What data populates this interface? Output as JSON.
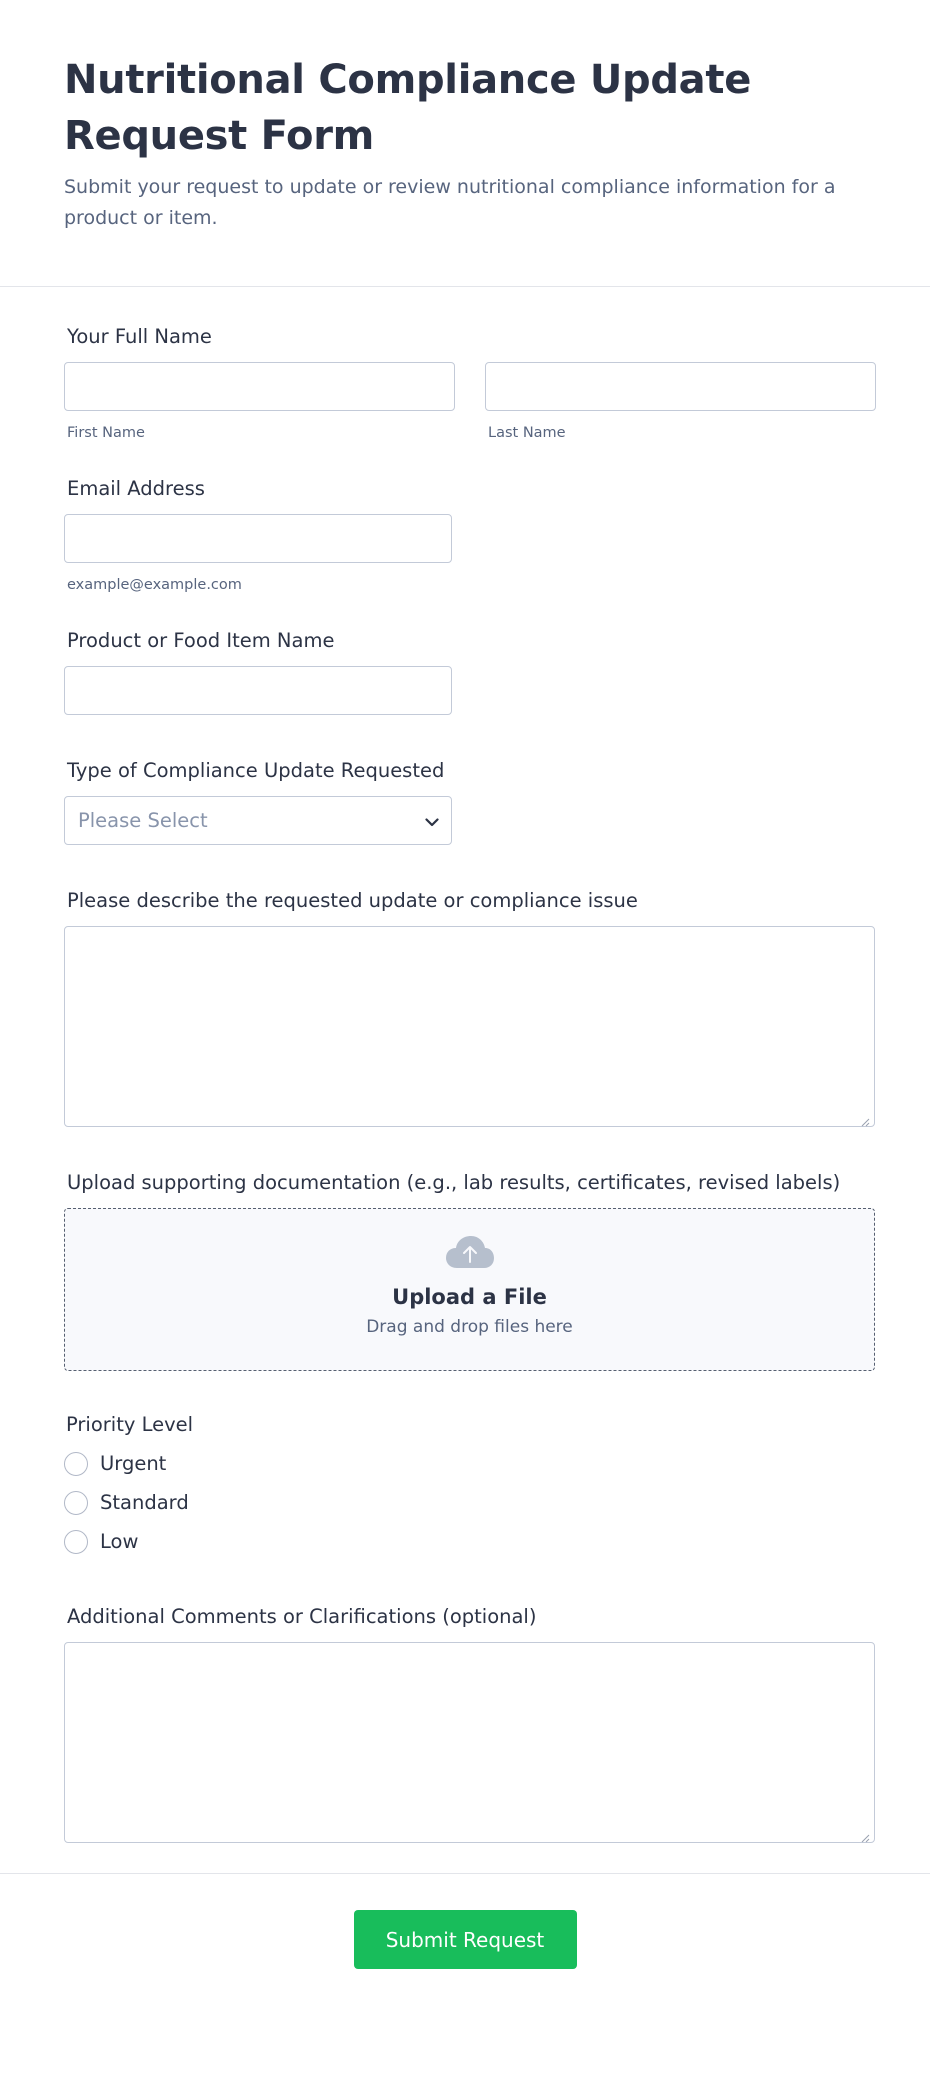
{
  "header": {
    "title": "Nutritional Compliance Update Request Form",
    "subtitle": "Submit your request to update or review nutritional compliance information for a product or item."
  },
  "fields": {
    "full_name": {
      "label": "Your Full Name",
      "first_sublabel": "First Name",
      "last_sublabel": "Last Name",
      "first_value": "",
      "last_value": ""
    },
    "email": {
      "label": "Email Address",
      "sublabel": "example@example.com",
      "value": ""
    },
    "product": {
      "label": "Product or Food Item Name",
      "value": ""
    },
    "compliance_type": {
      "label": "Type of Compliance Update Requested",
      "selected": "Please Select"
    },
    "description": {
      "label": "Please describe the requested update or compliance issue",
      "value": ""
    },
    "upload": {
      "label": "Upload supporting documentation (e.g., lab results, certificates, revised labels)",
      "title": "Upload a File",
      "hint": "Drag and drop files here"
    },
    "priority": {
      "label": "Priority Level",
      "options": [
        "Urgent",
        "Standard",
        "Low"
      ]
    },
    "comments": {
      "label": "Additional Comments or Clarifications (optional)",
      "value": ""
    }
  },
  "submit_label": "Submit Request",
  "colors": {
    "accent": "#18bd5b",
    "text": "#2c3345",
    "muted": "#57647e",
    "border": "#c3cad8"
  },
  "icons": {
    "upload": "cloud-upload-icon",
    "select": "chevron-down-icon"
  }
}
